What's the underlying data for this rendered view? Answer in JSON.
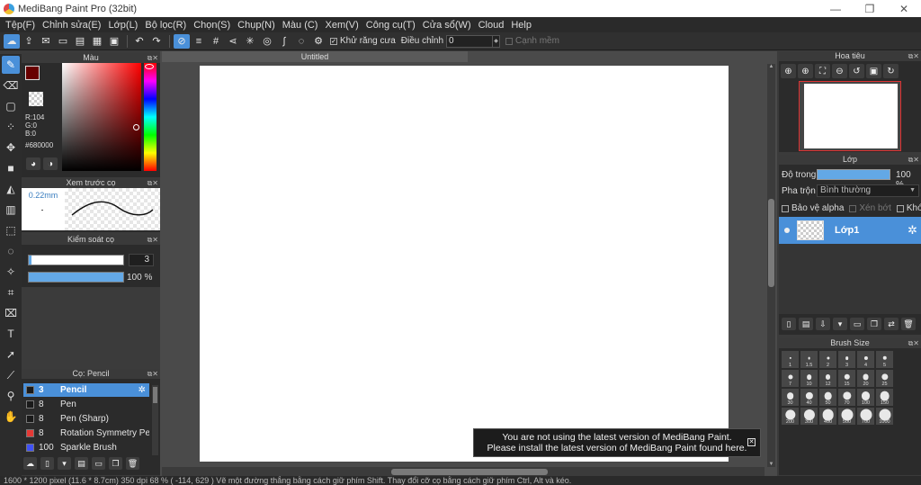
{
  "window": {
    "title": "MediBang Paint Pro (32bit)",
    "minimize": "—",
    "maximize": "❐",
    "close": "✕"
  },
  "menu": [
    "Tệp(F)",
    "Chỉnh sửa(E)",
    "Lớp(L)",
    "Bộ lọc(R)",
    "Chọn(S)",
    "Chụp(N)",
    "Màu (C)",
    "Xem(V)",
    "Công cụ(T)",
    "Cửa sổ(W)",
    "Cloud",
    "Help"
  ],
  "toolbar": {
    "antialias_label": "Khử răng cưa",
    "correction_label": "Điều chỉnh",
    "correction_value": "0",
    "edge_label": "Cạnh mềm"
  },
  "panels": {
    "color": {
      "title": "Màu",
      "rgb_r": "R:104",
      "rgb_g": "G:0",
      "rgb_b": "B:0",
      "hex": "#680000",
      "current_color": "#680000"
    },
    "preview": {
      "title": "Xem trước cọ",
      "size": "0.22mm"
    },
    "control": {
      "title": "Kiểm soát cọ",
      "size_value": "3",
      "opacity_value": "100 %",
      "size_fraction": 0.03,
      "opacity_fraction": 1.0
    },
    "brush": {
      "title": "Cọ: Pencil",
      "items": [
        {
          "size": "3",
          "name": "Pencil",
          "color": "#1a1a1a",
          "selected": true
        },
        {
          "size": "8",
          "name": "Pen",
          "color": "#1a1a1a",
          "selected": false
        },
        {
          "size": "8",
          "name": "Pen (Sharp)",
          "color": "#1a1a1a",
          "selected": false
        },
        {
          "size": "8",
          "name": "Rotation Symmetry Pen",
          "color": "#e53935",
          "selected": false
        },
        {
          "size": "100",
          "name": "Sparkle Brush",
          "color": "#3f51f5",
          "selected": false
        }
      ]
    },
    "navigator": {
      "title": "Hoa tiêu"
    },
    "layer": {
      "title": "Lớp",
      "opacity_label": "Độ trong",
      "opacity_value": "100 %",
      "blend_label": "Pha trộn",
      "blend_value": "Bình thường",
      "lock_alpha": "Bảo vệ alpha",
      "clipping": "Xén bớt",
      "lock": "Khóa",
      "layers": [
        {
          "name": "Lớp1",
          "selected": true
        }
      ]
    },
    "brush_size": {
      "title": "Brush Size",
      "sizes": [
        "1",
        "1.5",
        "2",
        "3",
        "4",
        "5",
        "7",
        "10",
        "12",
        "15",
        "20",
        "25",
        "30",
        "40",
        "50",
        "70",
        "100",
        "150",
        "200",
        "300",
        "400",
        "500",
        "700",
        "1000"
      ]
    }
  },
  "document": {
    "tab_title": "Untitled"
  },
  "notification": {
    "line1": "You are not using the latest version of MediBang Paint.",
    "line2": "Please install the latest version of MediBang Paint found here."
  },
  "status": {
    "text": "1600 * 1200 pixel   (11.6 * 8.7cm)   350 dpi   68 %   ( -114, 629 )   Vẽ một đường thẳng bằng cách giữ phím Shift. Thay đổi cỡ cọ bằng cách giữ phím Ctrl, Alt và kéo."
  }
}
